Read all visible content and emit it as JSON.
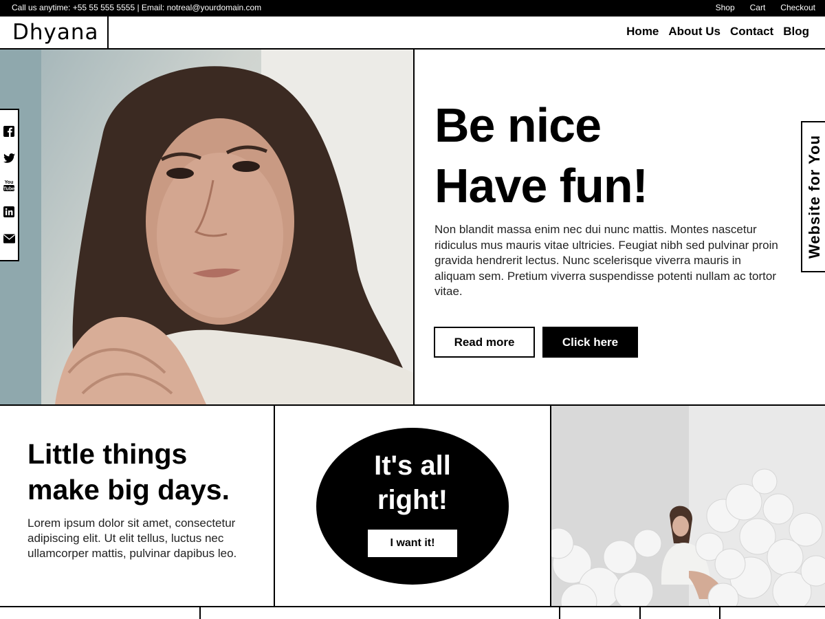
{
  "topbar": {
    "contact": "Call us anytime: +55 55 555 5555 | Email: notreal@yourdomain.com",
    "links": [
      "Shop",
      "Cart",
      "Checkout"
    ]
  },
  "header": {
    "logo": "Dhyana",
    "nav": [
      "Home",
      "About Us",
      "Contact",
      "Blog"
    ]
  },
  "social_icons": [
    "facebook-icon",
    "twitter-icon",
    "youtube-icon",
    "linkedin-icon",
    "email-icon"
  ],
  "hero": {
    "title_line1": "Be nice",
    "title_line2": "Have fun!",
    "text": "Non blandit massa enim nec dui nunc mattis. Montes nascetur ridiculus mus mauris vitae ultricies. Feugiat nibh sed pulvinar proin gravida hendrerit lectus. Nunc scelerisque viverra mauris in aliquam sem. Pretium viverra suspendisse potenti nullam ac tortor vitae.",
    "btn_read_more": "Read more",
    "btn_click_here": "Click here",
    "side_tab": "Website for You"
  },
  "little_things": {
    "title_line1": "Little things",
    "title_line2": "make big days.",
    "text": "Lorem ipsum dolor sit amet, consectetur adipiscing elit. Ut elit tellus, luctus nec ullamcorper mattis, pulvinar dapibus leo."
  },
  "promo": {
    "title_line1": "It's all",
    "title_line2": "right!",
    "button": "I want it!"
  },
  "colors": {
    "primary": "#000000",
    "background": "#ffffff",
    "text": "#222222"
  }
}
